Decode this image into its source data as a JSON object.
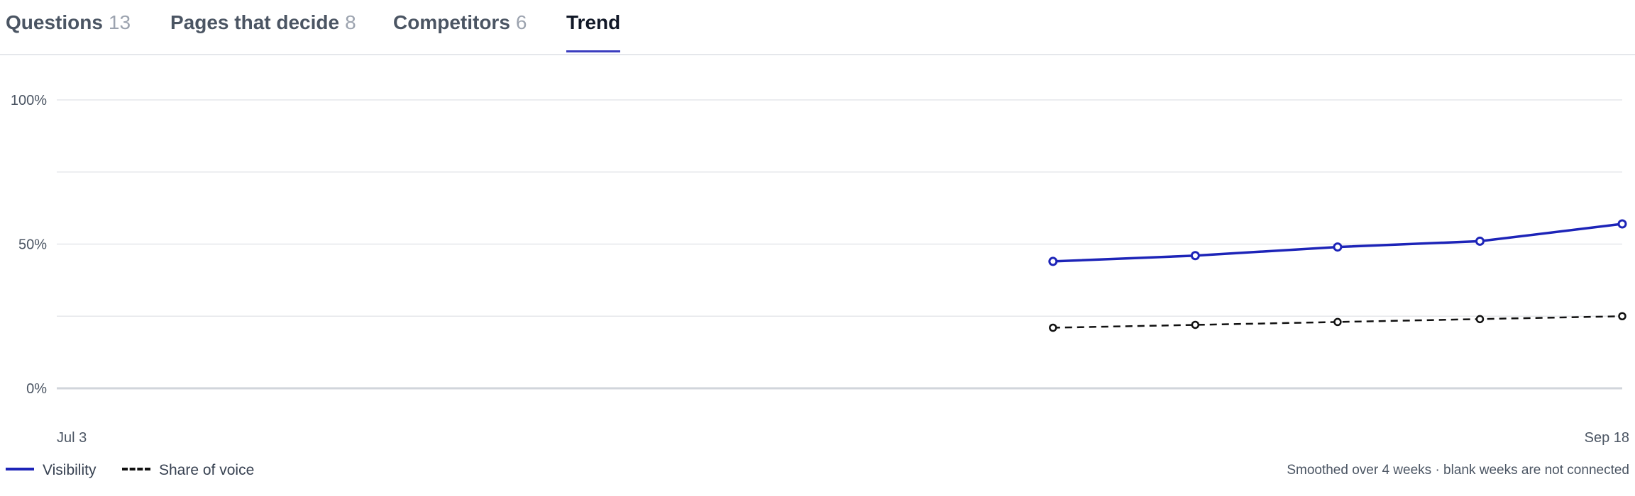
{
  "tabs": [
    {
      "label": "Questions",
      "count": "13"
    },
    {
      "label": "Pages that decide",
      "count": "8"
    },
    {
      "label": "Competitors",
      "count": "6"
    },
    {
      "label": "Trend",
      "count": ""
    }
  ],
  "active_tab": "Trend",
  "colors": {
    "visibility": "#1d24b8",
    "share_of_voice": "#111111",
    "accent": "#3b3dbf",
    "grid": "#e5e7eb"
  },
  "chart_data": {
    "type": "line",
    "x_tick_labels": [
      "Jul 3",
      "Sep 18"
    ],
    "y_tick_labels": [
      "100%",
      "50%",
      "0%"
    ],
    "ylim": [
      0,
      100
    ],
    "grid": true,
    "legend_placement": "bottom-left",
    "x_weeks_total": 12,
    "series": [
      {
        "name": "Visibility",
        "style": "solid",
        "week_index": [
          7,
          8,
          9,
          10,
          11
        ],
        "values": [
          44,
          46,
          49,
          51,
          57
        ]
      },
      {
        "name": "Share of voice",
        "style": "dashed",
        "week_index": [
          7,
          8,
          9,
          10,
          11
        ],
        "values": [
          21,
          22,
          23,
          24,
          25
        ]
      }
    ]
  },
  "legend": {
    "visibility_label": "Visibility",
    "sov_label": "Share of voice"
  },
  "note": "Smoothed over 4 weeks · blank weeks are not connected"
}
